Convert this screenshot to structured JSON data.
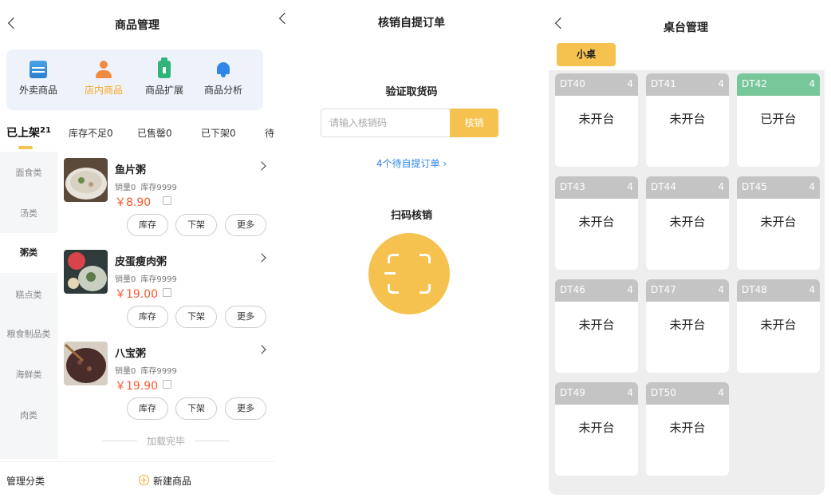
{
  "product_screen": {
    "title": "商品管理",
    "quick_actions": [
      {
        "label": "外卖商品",
        "icon": "takeout-icon"
      },
      {
        "label": "店内商品",
        "icon": "person-icon"
      },
      {
        "label": "商品扩展",
        "icon": "bottle-icon"
      },
      {
        "label": "商品分析",
        "icon": "bell-icon"
      }
    ],
    "tabs": [
      {
        "label": "已上架",
        "count": "21"
      },
      {
        "label": "库存不足0"
      },
      {
        "label": "已售罄0"
      },
      {
        "label": "已下架0"
      },
      {
        "label": "待"
      }
    ],
    "categories": [
      "面食类",
      "汤类",
      "粥类",
      "糕点类",
      "粮食制品类",
      "海鲜类",
      "肉类"
    ],
    "active_category": "粥类",
    "products": [
      {
        "name": "鱼片粥",
        "sales": "销量0",
        "stock": "库存9999",
        "price": "￥8.90"
      },
      {
        "name": "皮蛋瘦肉粥",
        "sales": "销量0",
        "stock": "库存9999",
        "price": "￥19.00"
      },
      {
        "name": "八宝粥",
        "sales": "销量0",
        "stock": "库存9999",
        "price": "￥19.90"
      }
    ],
    "buttons": {
      "stock": "库存",
      "off_shelf": "下架",
      "more": "更多"
    },
    "loaded_text": "加载完毕",
    "manage_category": "管理分类",
    "new_product": "新建商品"
  },
  "pickup_screen": {
    "title": "核销自提订单",
    "verify_title": "验证取货码",
    "input_placeholder": "请输入核销码",
    "verify_button": "核销",
    "pending_link": "4个待自提订单 ›",
    "scan_title": "扫码核销"
  },
  "table_screen": {
    "title": "桌台管理",
    "table_tab": "小桌",
    "tables": [
      {
        "code": "DT40",
        "seats": "4",
        "status": "未开台",
        "open": false
      },
      {
        "code": "DT41",
        "seats": "4",
        "status": "未开台",
        "open": false
      },
      {
        "code": "DT42",
        "seats": "4",
        "status": "已开台",
        "open": true
      },
      {
        "code": "DT43",
        "seats": "4",
        "status": "未开台",
        "open": false
      },
      {
        "code": "DT44",
        "seats": "4",
        "status": "未开台",
        "open": false
      },
      {
        "code": "DT45",
        "seats": "4",
        "status": "未开台",
        "open": false
      },
      {
        "code": "DT46",
        "seats": "4",
        "status": "未开台",
        "open": false
      },
      {
        "code": "DT47",
        "seats": "4",
        "status": "未开台",
        "open": false
      },
      {
        "code": "DT48",
        "seats": "4",
        "status": "未开台",
        "open": false
      },
      {
        "code": "DT49",
        "seats": "4",
        "status": "未开台",
        "open": false
      },
      {
        "code": "DT50",
        "seats": "4",
        "status": "未开台",
        "open": false
      }
    ]
  },
  "colors": {
    "accent": "#f5c24f",
    "price": "#f5592f",
    "link": "#2f86e8",
    "open_table": "#77c79a",
    "closed_table": "#c4c4c4"
  }
}
